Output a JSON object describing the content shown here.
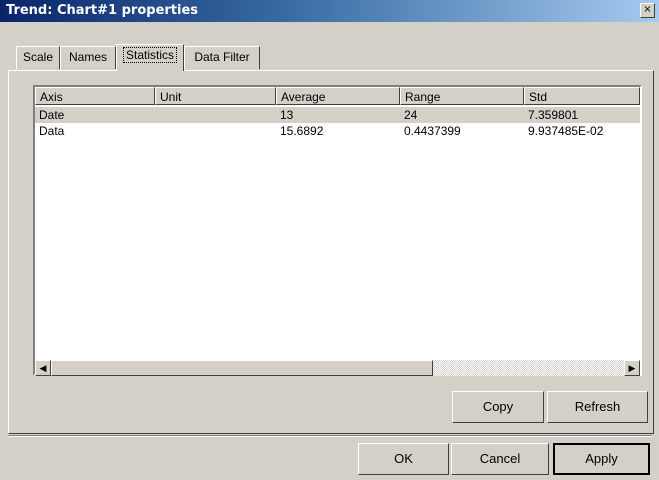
{
  "window": {
    "title": "Trend: Chart#1 properties",
    "close_label": "×"
  },
  "tabs": [
    {
      "label": "Scale"
    },
    {
      "label": "Names"
    },
    {
      "label": "Statistics",
      "active": true
    },
    {
      "label": "Data Filter"
    }
  ],
  "table": {
    "columns": [
      "Axis",
      "Unit",
      "Average",
      "Range",
      "Std"
    ],
    "rows": [
      {
        "axis": "Date",
        "unit": "",
        "average": "13",
        "range": "24",
        "std": "7.359801"
      },
      {
        "axis": "Data",
        "unit": "",
        "average": "15.6892",
        "range": "0.4437399",
        "std": "9.937485E-02"
      }
    ]
  },
  "scrollbar": {
    "left_arrow": "◀",
    "right_arrow": "▶"
  },
  "buttons": {
    "copy": "Copy",
    "refresh": "Refresh",
    "ok": "OK",
    "cancel": "Cancel",
    "apply": "Apply"
  }
}
